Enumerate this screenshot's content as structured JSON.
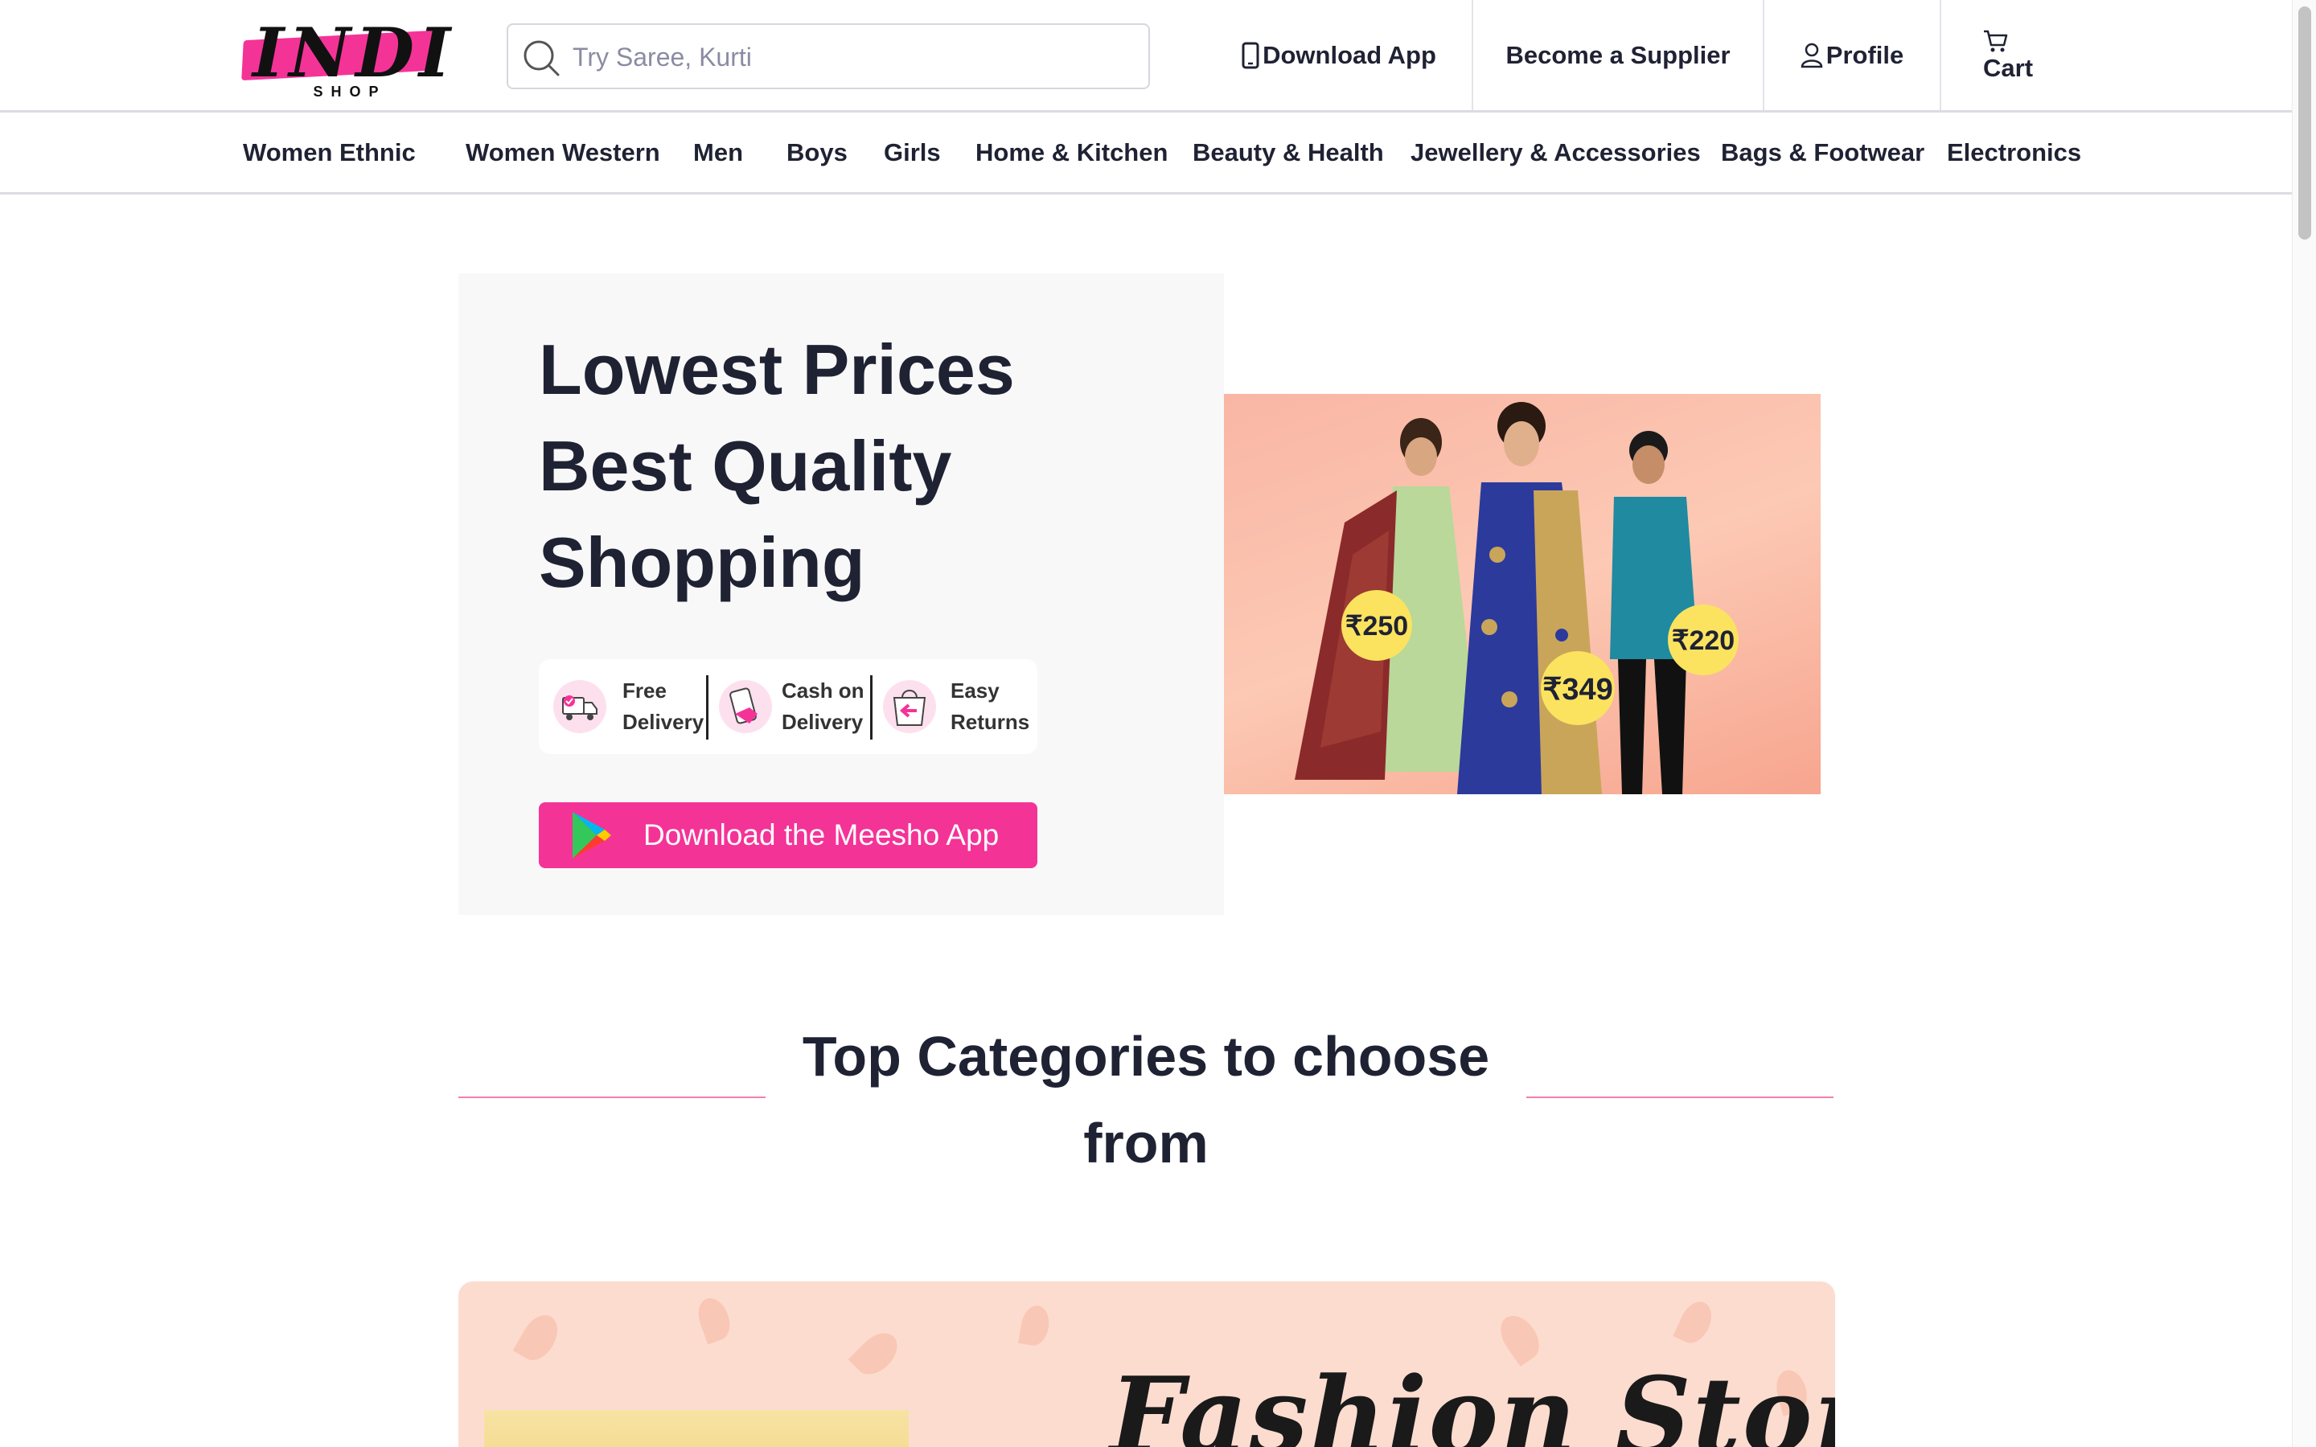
{
  "header": {
    "logo_text": "INDI",
    "logo_sub": "SHOP",
    "search_placeholder": "Try Saree, Kurti",
    "download_app": "Download App",
    "become_supplier": "Become a Supplier",
    "profile": "Profile",
    "cart": "Cart"
  },
  "categories": [
    "Women Ethnic",
    "Women Western",
    "Men",
    "Boys",
    "Girls",
    "Home & Kitchen",
    "Beauty & Health",
    "Jewellery & Accessories",
    "Bags & Footwear",
    "Electronics"
  ],
  "hero": {
    "title_lines": [
      "Lowest Prices",
      "Best Quality",
      "Shopping"
    ],
    "perks": [
      {
        "line1": "Free",
        "line2": "Delivery"
      },
      {
        "line1": "Cash on",
        "line2": "Delivery"
      },
      {
        "line1": "Easy",
        "line2": "Returns"
      }
    ],
    "cta": "Download the Meesho App",
    "price_tags": [
      "₹250",
      "₹349",
      "₹220"
    ]
  },
  "top_categories": {
    "title": "Top Categories to choose from"
  },
  "banner": {
    "title": "Fashion Store"
  },
  "colors": {
    "brand_pink": "#f43397",
    "text_dark": "#1f2233",
    "hero_bg": "#f8f8f8",
    "banner_bg": "#fddcd0",
    "price_tag_yellow": "#fbe35f"
  }
}
